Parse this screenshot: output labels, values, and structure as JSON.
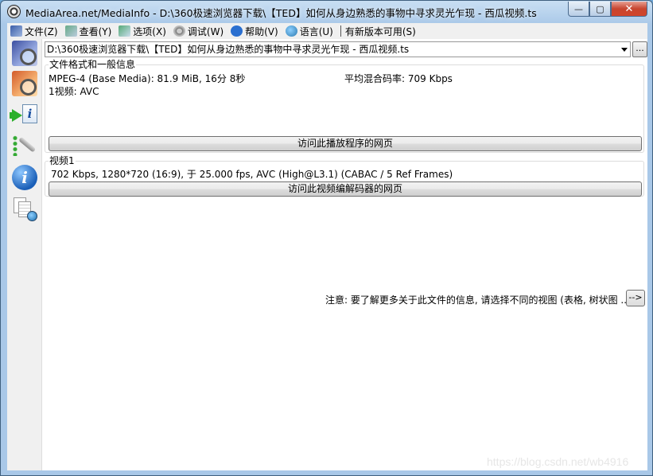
{
  "window": {
    "title": "MediaArea.net/MediaInfo - D:\\360极速浏览器下载\\【TED】如何从身边熟悉的事物中寻求灵光乍现 - 西瓜视频.ts",
    "minimize": "—",
    "maximize": "▢",
    "close": "✕"
  },
  "menu": {
    "file": "文件(Z)",
    "view": "查看(Y)",
    "options": "选项(X)",
    "debug": "调试(W)",
    "help": "帮助(V)",
    "language": "语言(U)",
    "new_version": "有新版本可用(S)"
  },
  "file_combo": {
    "value": "D:\\360极速浏览器下载\\【TED】如何从身边熟悉的事物中寻求灵光乍现 - 西瓜视频.ts",
    "browse": "..."
  },
  "general": {
    "title": "文件格式和一般信息",
    "format_line": "MPEG-4 (Base Media): 81.9 MiB, 16分 8秒",
    "bitrate_line": "平均混合码率: 709 Kbps",
    "streams_line": "1视频: AVC",
    "player_button": "访问此播放程序的网页"
  },
  "video": {
    "title": "视频1",
    "details": "702 Kbps, 1280*720 (16:9), 于 25.000 fps, AVC (High@L3.1) (CABAC / 5 Ref Frames)",
    "codec_button": "访问此视频编解码器的网页"
  },
  "note": {
    "text": "注意: 要了解更多关于此文件的信息, 请选择不同的视图 (表格, 树状图 ...)",
    "arrow": "-->"
  },
  "watermark": "https://blog.csdn.net/wb4916"
}
